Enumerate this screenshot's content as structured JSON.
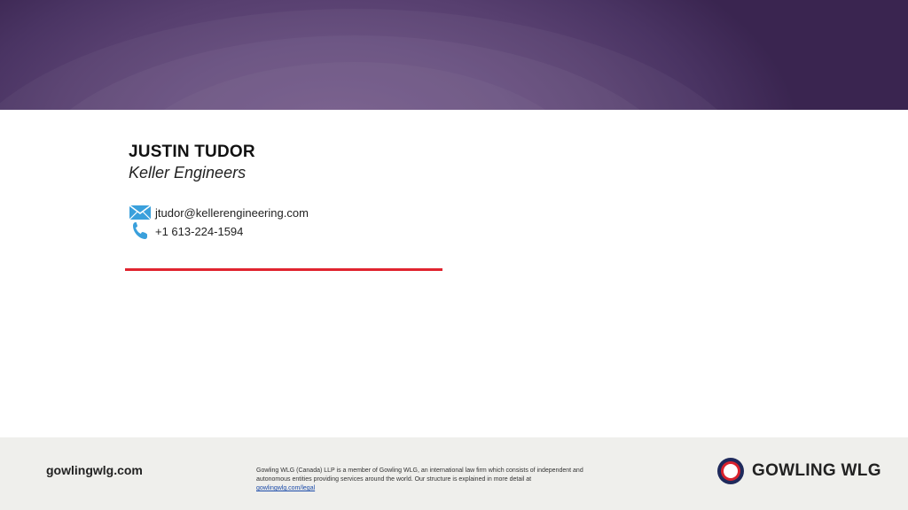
{
  "contact": {
    "name": "JUSTIN TUDOR",
    "company": "Keller Engineers",
    "email": "jtudor@kellerengineering.com",
    "phone": "+1 613-224-1594",
    "email_icon": "envelope-icon",
    "phone_icon": "phone-icon"
  },
  "footer": {
    "website": "gowlingwlg.com",
    "legal_text": "Gowling WLG (Canada) LLP is a member of Gowling WLG, an international law firm which consists of independent and autonomous entities providing services around the world. Our structure is explained in more detail at",
    "legal_link": "gowlingwlg.com/legal",
    "logo_text": "GOWLING WLG"
  },
  "colors": {
    "banner": "#4a3463",
    "accent_rule": "#e0242f",
    "logo_navy": "#1f2a5c",
    "logo_red": "#d9232e",
    "icon_blue": "#3aa0dc",
    "footer_bg": "#efefec"
  }
}
